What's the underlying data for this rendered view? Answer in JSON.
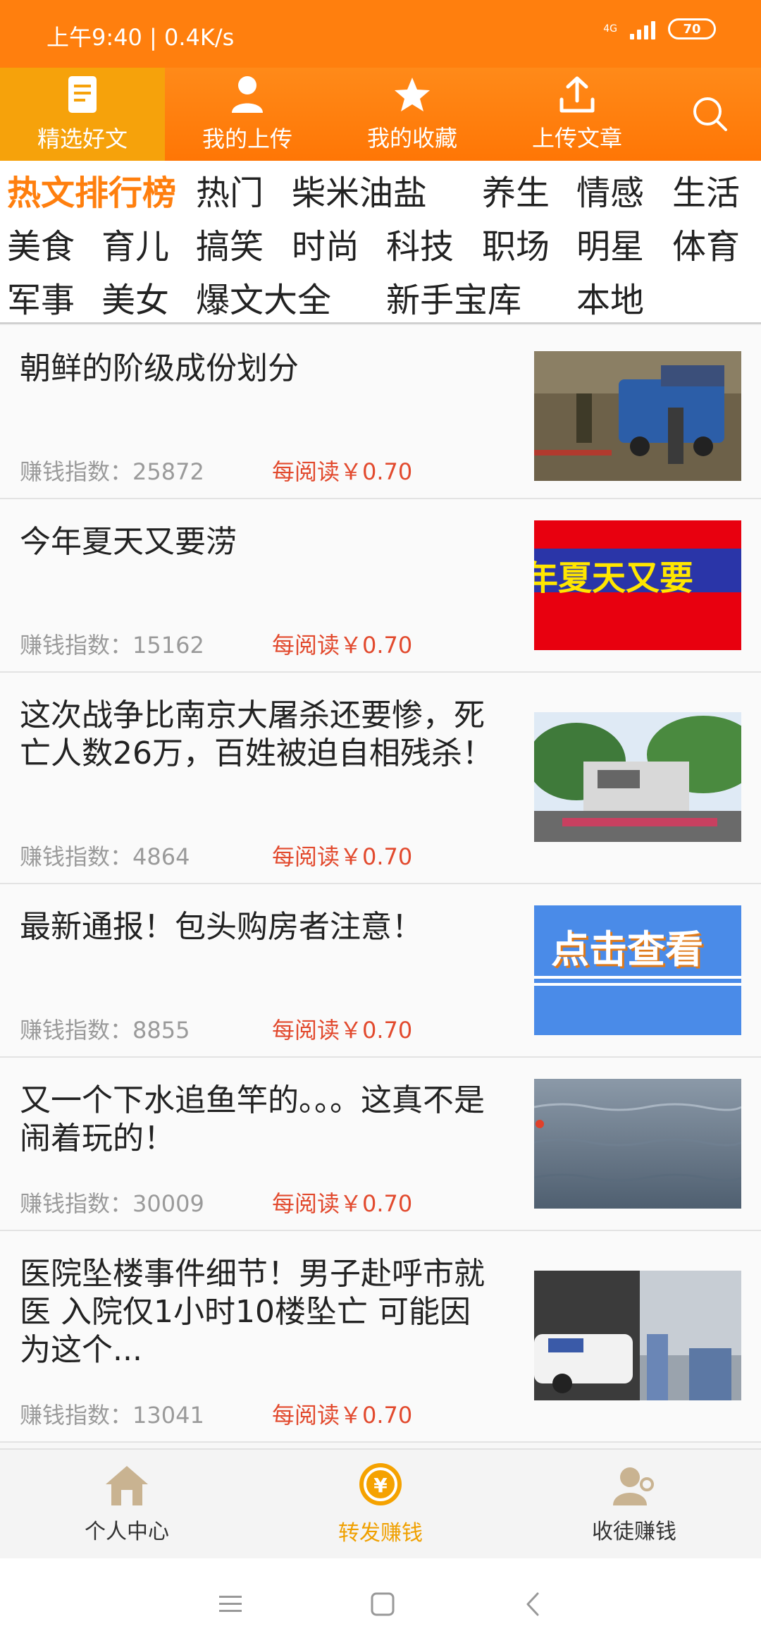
{
  "status": {
    "time": "上午9:40 | 0.4K/s",
    "network": "4G",
    "battery": "70"
  },
  "topnav": {
    "items": [
      {
        "label": "精选好文",
        "icon": "document-icon"
      },
      {
        "label": "我的上传",
        "icon": "user-icon"
      },
      {
        "label": "我的收藏",
        "icon": "star-icon"
      },
      {
        "label": "上传文章",
        "icon": "upload-icon"
      }
    ],
    "search_icon": "search-icon"
  },
  "categories": [
    "热文排行榜",
    "热门",
    "柴米油盐",
    "养生",
    "情感",
    "生活",
    "美食",
    "育儿",
    "搞笑",
    "时尚",
    "科技",
    "职场",
    "明星",
    "体育",
    "军事",
    "美女",
    "爆文大全",
    "新手宝库",
    "本地"
  ],
  "articles": [
    {
      "title": "朝鲜的阶级成份划分",
      "score": "赚钱指数：25872",
      "price": "每阅读￥0.70"
    },
    {
      "title": "今年夏天又要涝",
      "score": "赚钱指数：15162",
      "price": "每阅读￥0.70",
      "thumb_text": "年夏天又要"
    },
    {
      "title": "这次战争比南京大屠杀还要惨，死亡人数26万，百姓被迫自相残杀！",
      "score": "赚钱指数：4864",
      "price": "每阅读￥0.70"
    },
    {
      "title": "最新通报！包头购房者注意！",
      "score": "赚钱指数：8855",
      "price": "每阅读￥0.70",
      "thumb_text": "点击查看"
    },
    {
      "title": "又一个下水追鱼竿的。。。这真不是闹着玩的！",
      "score": "赚钱指数：30009",
      "price": "每阅读￥0.70"
    },
    {
      "title": "医院坠楼事件细节！男子赴呼市就医 入院仅1小时10楼坠亡 可能因为这个...",
      "score": "赚钱指数：13041",
      "price": "每阅读￥0.70"
    }
  ],
  "tabbar": {
    "items": [
      {
        "label": "个人中心",
        "icon": "home-icon"
      },
      {
        "label": "转发赚钱",
        "icon": "coin-icon"
      },
      {
        "label": "收徒赚钱",
        "icon": "apprentice-icon"
      }
    ],
    "active": "转发赚钱"
  },
  "colors": {
    "brand": "#ff7f0e",
    "active_tab": "#f0a000",
    "price": "#e24a2e"
  }
}
